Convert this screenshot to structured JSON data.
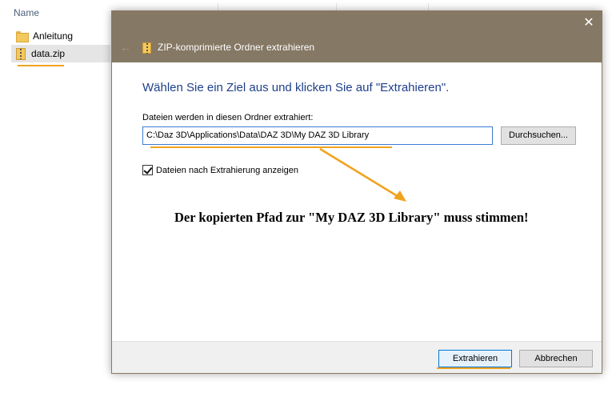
{
  "explorer": {
    "column_header": "Name",
    "files": [
      {
        "name": "Anleitung",
        "icon": "folder-icon"
      },
      {
        "name": "data.zip",
        "icon": "zip-icon"
      }
    ]
  },
  "dialog": {
    "title": "ZIP-komprimierte Ordner extrahieren",
    "close_glyph": "✕",
    "back_glyph": "←",
    "heading": "Wählen Sie ein Ziel aus und klicken Sie auf \"Extrahieren\".",
    "destination_label": "Dateien werden in diesen Ordner extrahiert:",
    "destination_path": "C:\\Daz 3D\\Applications\\Data\\DAZ 3D\\My DAZ 3D Library",
    "browse_label": "Durchsuchen...",
    "show_files_label": "Dateien nach Extrahierung anzeigen",
    "show_files_checked": true,
    "extract_label": "Extrahieren",
    "cancel_label": "Abbrechen"
  },
  "annotation": {
    "text": "Der kopierten Pfad zur \"My DAZ 3D Library\" muss stimmen!"
  },
  "colors": {
    "title_bar": "#857864",
    "highlight": "#f0a31e",
    "heading": "#1e3f8a",
    "focus_border": "#0078d7"
  }
}
